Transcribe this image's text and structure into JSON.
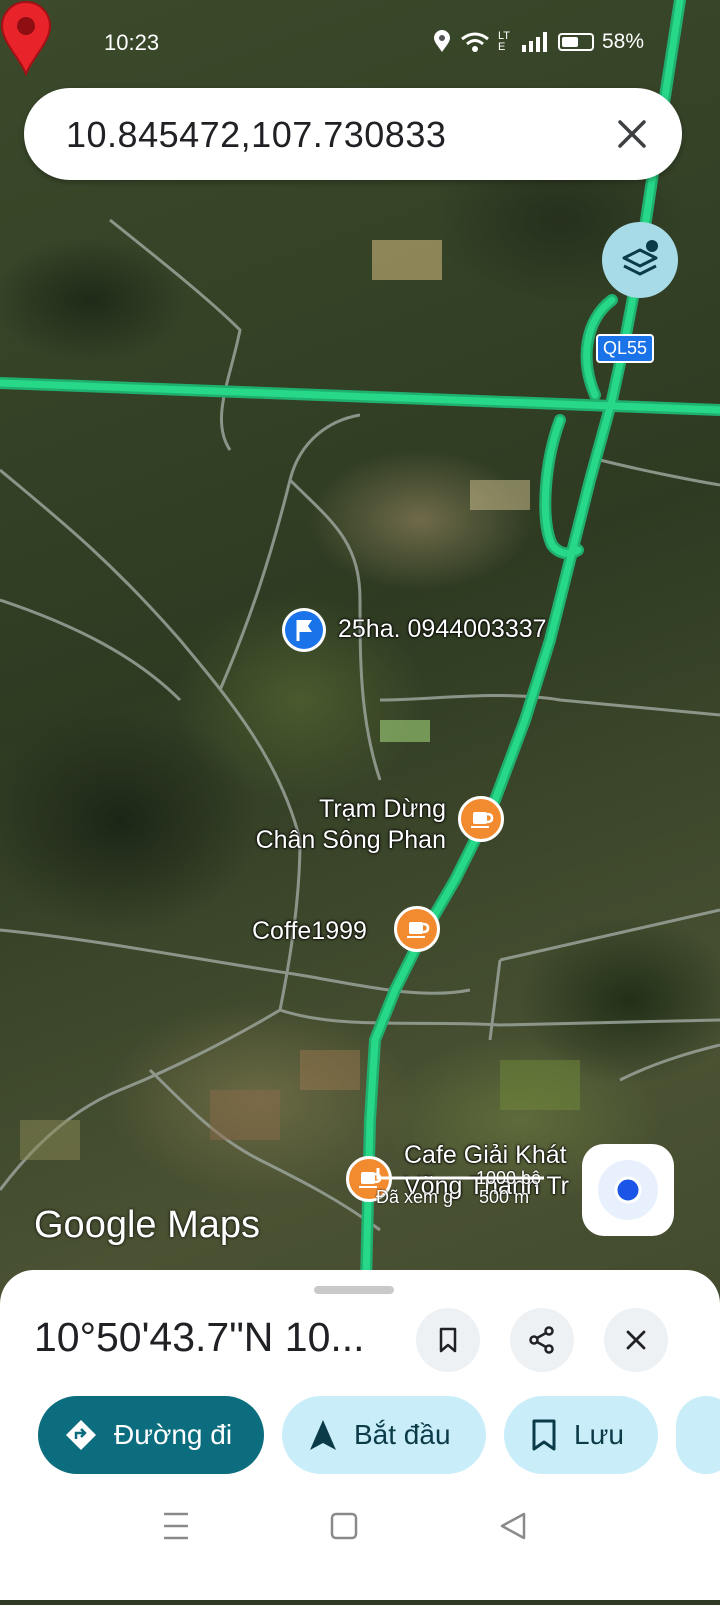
{
  "status_bar": {
    "time": "10:23",
    "battery": "58%",
    "network": "LTE"
  },
  "search": {
    "value": "10.845472,107.730833"
  },
  "map": {
    "road_shield": "QL55",
    "pois": [
      {
        "label": "25ha. 0944003337",
        "type": "flag"
      },
      {
        "label": "Trạm Dừng\nChân Sông Phan",
        "type": "cafe"
      },
      {
        "label": "Coffe1999",
        "type": "cafe"
      },
      {
        "label": "Cafe Giải Khát\nVõng Thanh Tr",
        "type": "cafe"
      }
    ],
    "scale_ft": "1000 bộ",
    "scale_m": "500 m",
    "viewed_hint": "Đã xem g",
    "logo": "Google Maps"
  },
  "sheet": {
    "coordinates": "10°50'43.7\"N 10...",
    "actions": {
      "directions": "Đường đi",
      "start": "Bắt đầu",
      "save": "Lưu"
    }
  },
  "colors": {
    "route_green": "#27d889",
    "primary": "#0b6d7d",
    "chip_bg": "#c9eef9",
    "cafe_orange": "#f28b30",
    "pin_red": "#e8232a"
  }
}
